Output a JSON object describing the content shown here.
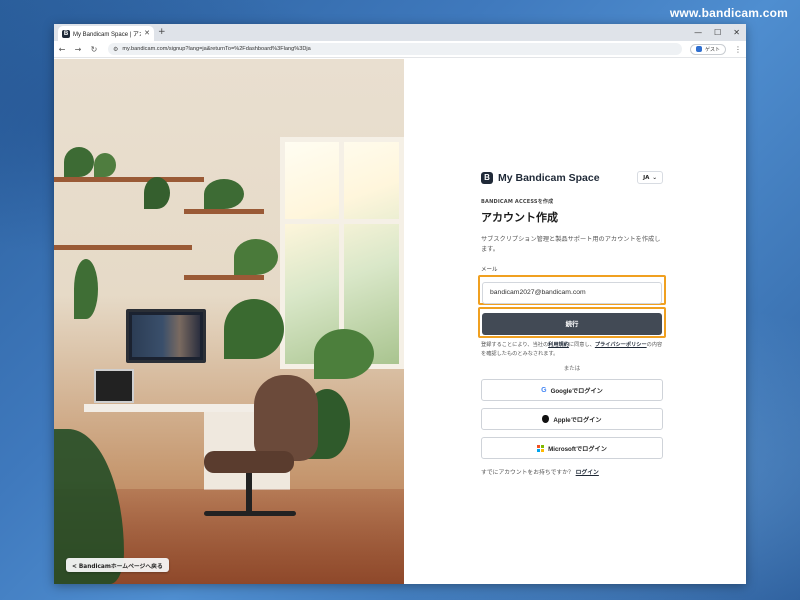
{
  "watermark": "www.bandicam.com",
  "browser": {
    "tab_title": "My Bandicam Space | アカウン",
    "tab_favicon": "B",
    "new_tab": "+",
    "url": "my.bandicam.com/signup?lang=ja&returnTo=%2Fdashboard%3Flang%3Dja",
    "profile_label": "ゲスト",
    "window_controls": [
      "—",
      "☐",
      "✕"
    ]
  },
  "photo": {
    "back_label": "< Bandicamホームページへ戻る"
  },
  "form": {
    "logo_letter": "B",
    "brand_name": "My Bandicam Space",
    "lang": "JA",
    "eyebrow": "BANDICAM ACCESSを作成",
    "title": "アカウント作成",
    "description": "サブスクリプション管理と製品サポート用のアカウントを作成します。",
    "email_label": "メール",
    "email_value": "bandicam2027@bandicam.com",
    "continue_label": "続行",
    "terms_prefix": "登録することにより、当社の",
    "terms_link": "利用規約",
    "terms_middle": "に同意し、",
    "privacy_link": "プライバシーポリシー",
    "terms_suffix": "の内容を確認したものとみなされます。",
    "or_label": "または",
    "google_label": "Googleでログイン",
    "apple_label": "Appleでログイン",
    "microsoft_label": "Microsoftでログイン",
    "signin_prefix": "すでにアカウントをお持ちですか？",
    "signin_link": "ログイン"
  },
  "colors": {
    "highlight": "#f0a020",
    "primary_button": "#424a55",
    "brand_dark": "#1f2937"
  }
}
